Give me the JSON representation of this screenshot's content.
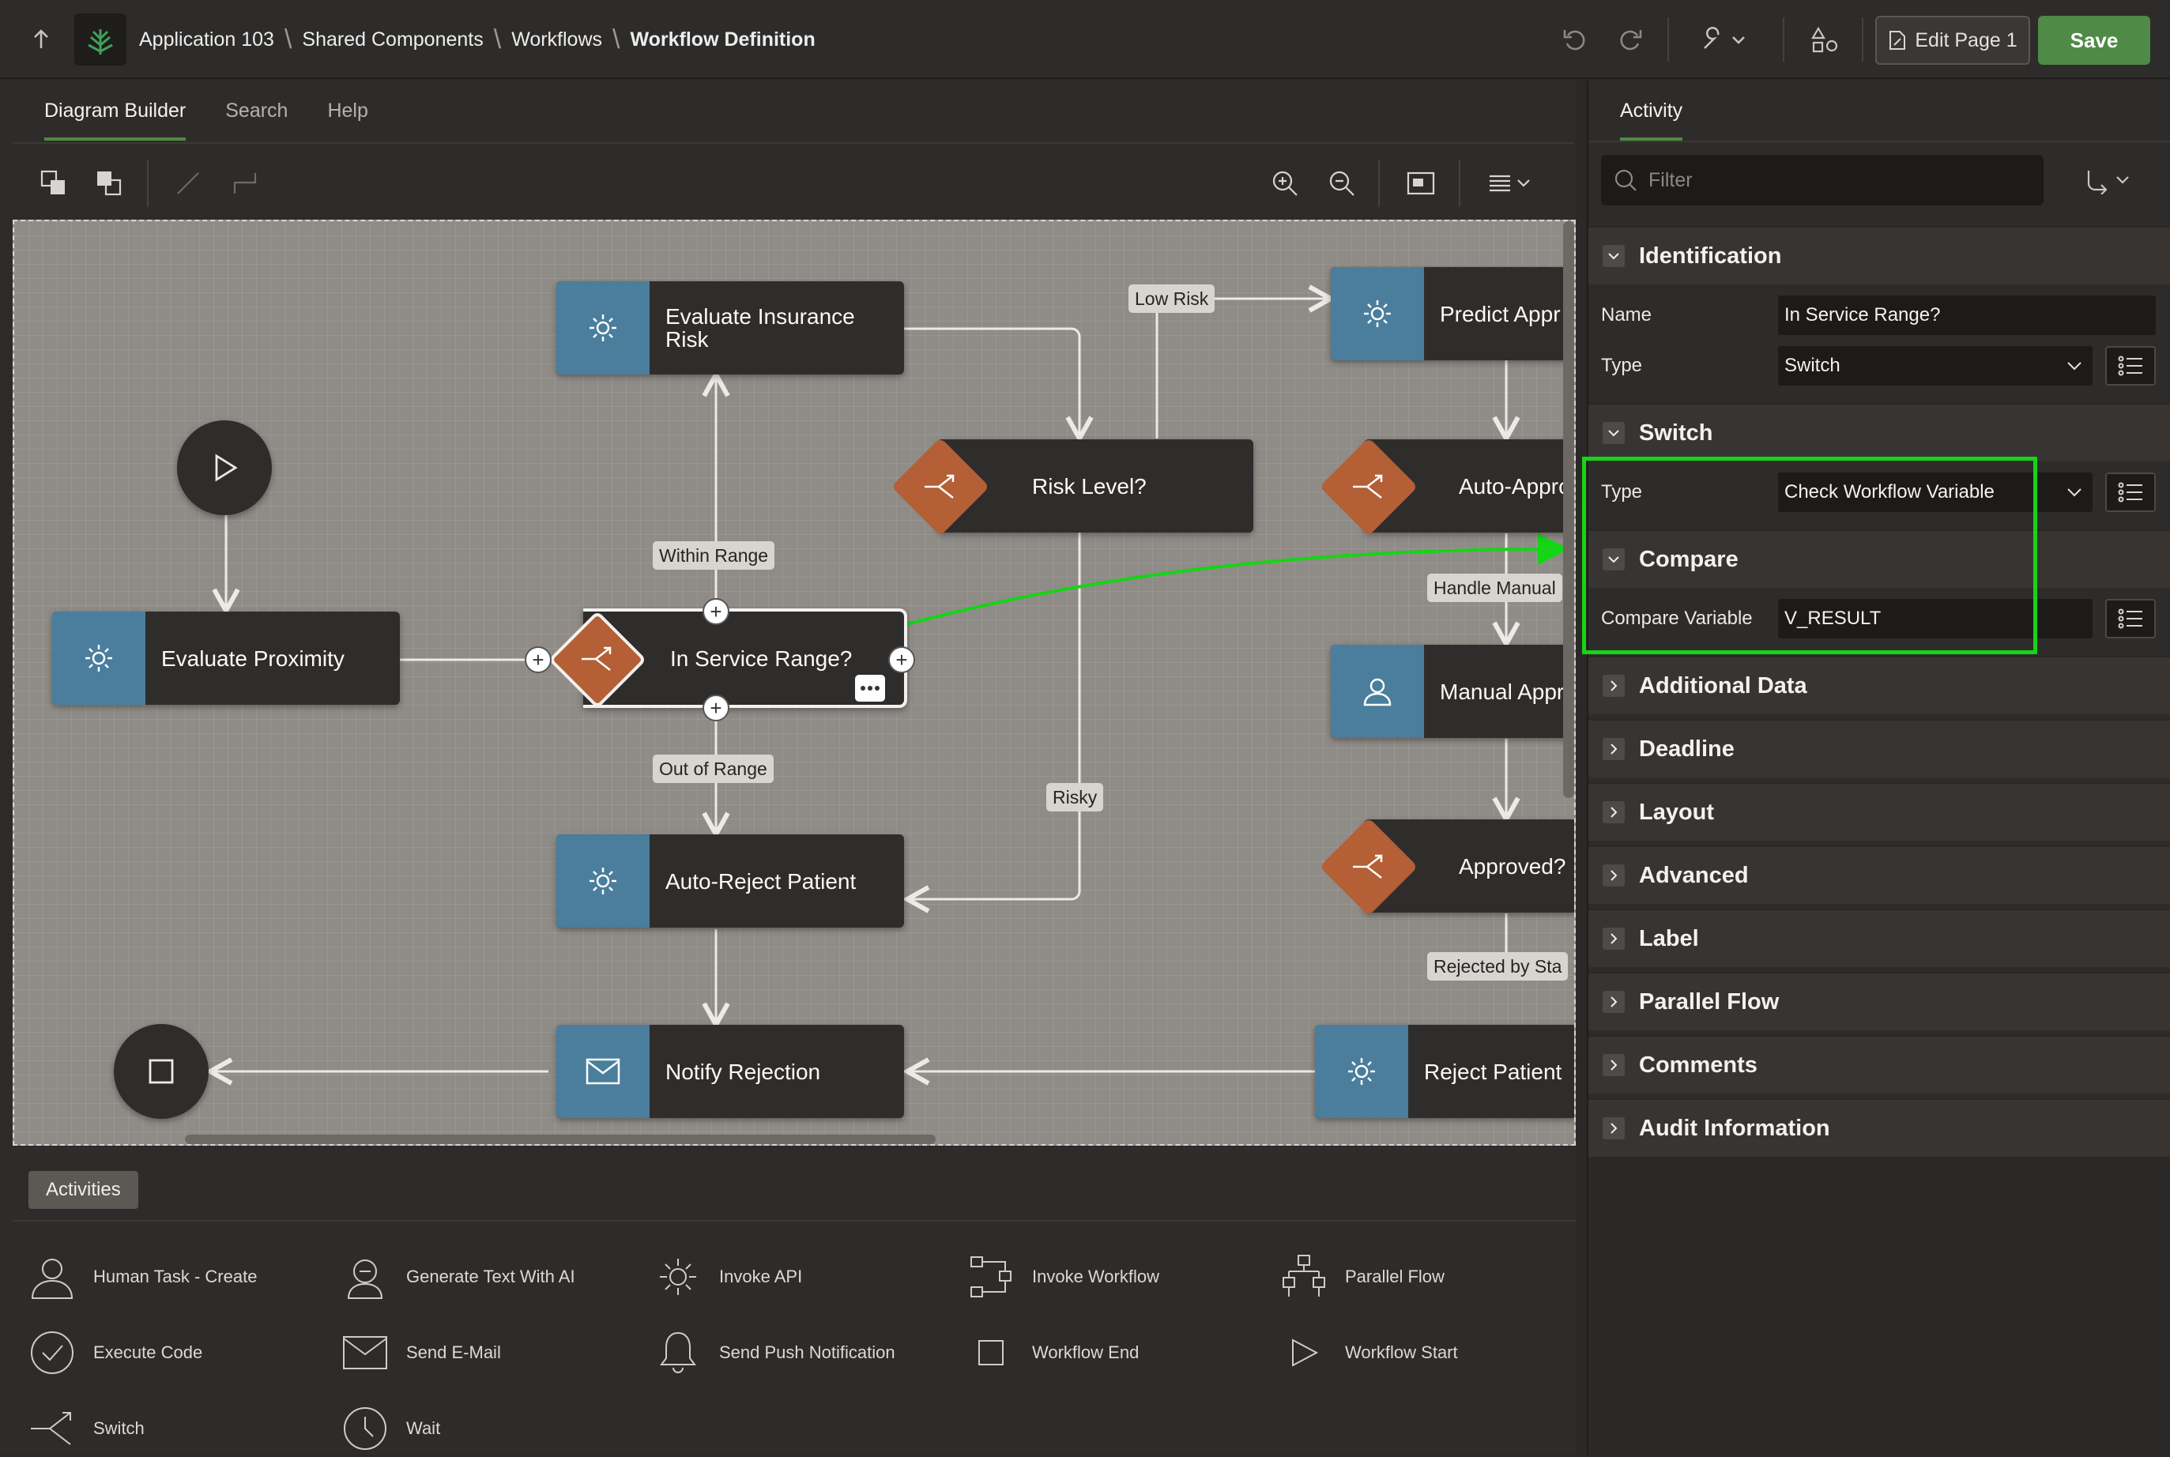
{
  "header": {
    "breadcrumbs": [
      "Application 103",
      "Shared Components",
      "Workflows",
      "Workflow Definition"
    ],
    "edit_page_label": "Edit Page 1",
    "save_label": "Save"
  },
  "left_tabs": [
    "Diagram Builder",
    "Search",
    "Help"
  ],
  "diagram": {
    "nodes": {
      "evaluate_insurance_risk": "Evaluate Insurance Risk",
      "predict_approval": "Predict Appr",
      "risk_level": "Risk Level?",
      "auto_approve": "Auto-Approv",
      "evaluate_proximity": "Evaluate Proximity",
      "in_service_range": "In Service Range?",
      "manual_approval": "Manual Appr",
      "auto_reject_patient": "Auto-Reject Patient",
      "approved": "Approved?",
      "notify_rejection": "Notify Rejection",
      "reject_patient": "Reject Patient"
    },
    "edge_labels": {
      "low_risk": "Low Risk",
      "within_range": "Within Range",
      "handle_manual": "Handle Manual",
      "out_of_range": "Out of Range",
      "risky": "Risky",
      "rejected_by": "Rejected by Sta"
    }
  },
  "palette": {
    "tab": "Activities",
    "items": [
      "Human Task - Create",
      "Generate Text With AI",
      "Invoke API",
      "Invoke Workflow",
      "Parallel Flow",
      "Execute Code",
      "Send E-Mail",
      "Send Push Notification",
      "Workflow End",
      "Workflow Start",
      "Switch",
      "Wait"
    ]
  },
  "properties": {
    "tab": "Activity",
    "filter_placeholder": "Filter",
    "identification": {
      "title": "Identification",
      "name_label": "Name",
      "name_value": "In Service Range?",
      "type_label": "Type",
      "type_value": "Switch"
    },
    "switch": {
      "title": "Switch",
      "type_label": "Type",
      "type_value": "Check Workflow Variable"
    },
    "compare": {
      "title": "Compare",
      "variable_label": "Compare Variable",
      "variable_value": "V_RESULT"
    },
    "collapsed_sections": [
      "Additional Data",
      "Deadline",
      "Layout",
      "Advanced",
      "Label",
      "Parallel Flow",
      "Comments",
      "Audit Information"
    ]
  },
  "colors": {
    "accent_green": "#4f8a46",
    "highlight": "#16d416",
    "task_blue": "#4a7e9c",
    "switch_orange": "#b45f36"
  }
}
